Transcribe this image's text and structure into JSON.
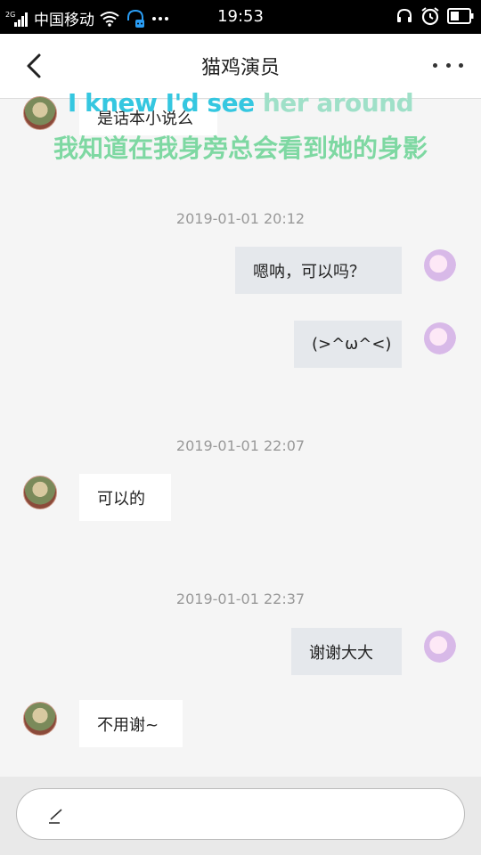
{
  "status_bar": {
    "signal_label": "2G",
    "carrier": "中国移动",
    "time": "19:53",
    "icons": [
      "signal-icon",
      "wifi-icon",
      "headset-status-icon",
      "more-notifications-icon",
      "headphone-icon",
      "alarm-icon",
      "battery-icon"
    ]
  },
  "header": {
    "title": "猫鸡演员",
    "back_icon": "chevron-left-icon",
    "more_icon": "more-dots-icon"
  },
  "subtitles": {
    "en_highlight": "I knew I'd see",
    "en_rest": " her around",
    "zh": "我知道在我身旁总会看到她的身影"
  },
  "messages": [
    {
      "side": "left",
      "text": "是话本小说么"
    },
    {
      "timestamp": "2019-01-01 20:12"
    },
    {
      "side": "right",
      "text": "嗯呐，可以吗？"
    },
    {
      "side": "right",
      "text": "(>^ω^<)"
    },
    {
      "timestamp": "2019-01-01 22:07"
    },
    {
      "side": "left",
      "text": "可以的"
    },
    {
      "timestamp": "2019-01-01 22:37"
    },
    {
      "side": "right",
      "text": "谢谢大大"
    },
    {
      "side": "left",
      "text": "不用谢~"
    }
  ],
  "input": {
    "placeholder": "",
    "icon": "pen-icon"
  }
}
